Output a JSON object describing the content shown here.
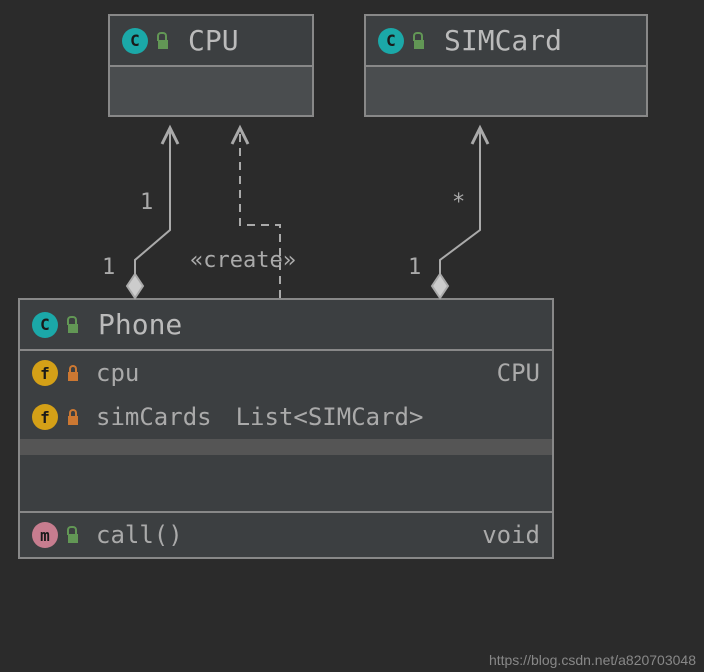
{
  "classes": {
    "cpu": {
      "name": "CPU"
    },
    "simcard": {
      "name": "SIMCard"
    },
    "phone": {
      "name": "Phone",
      "fields": [
        {
          "name": "cpu",
          "type": "CPU"
        },
        {
          "name": "simCards",
          "type": "List<SIMCard>"
        }
      ],
      "methods": [
        {
          "name": "call()",
          "returnType": "void"
        }
      ]
    }
  },
  "relationships": {
    "create_label": "«create»",
    "cpu_mult_top": "1",
    "cpu_mult_bottom": "1",
    "simcard_mult_top": "*",
    "simcard_mult_bottom": "1"
  },
  "watermark": "https://blog.csdn.net/a820703048"
}
